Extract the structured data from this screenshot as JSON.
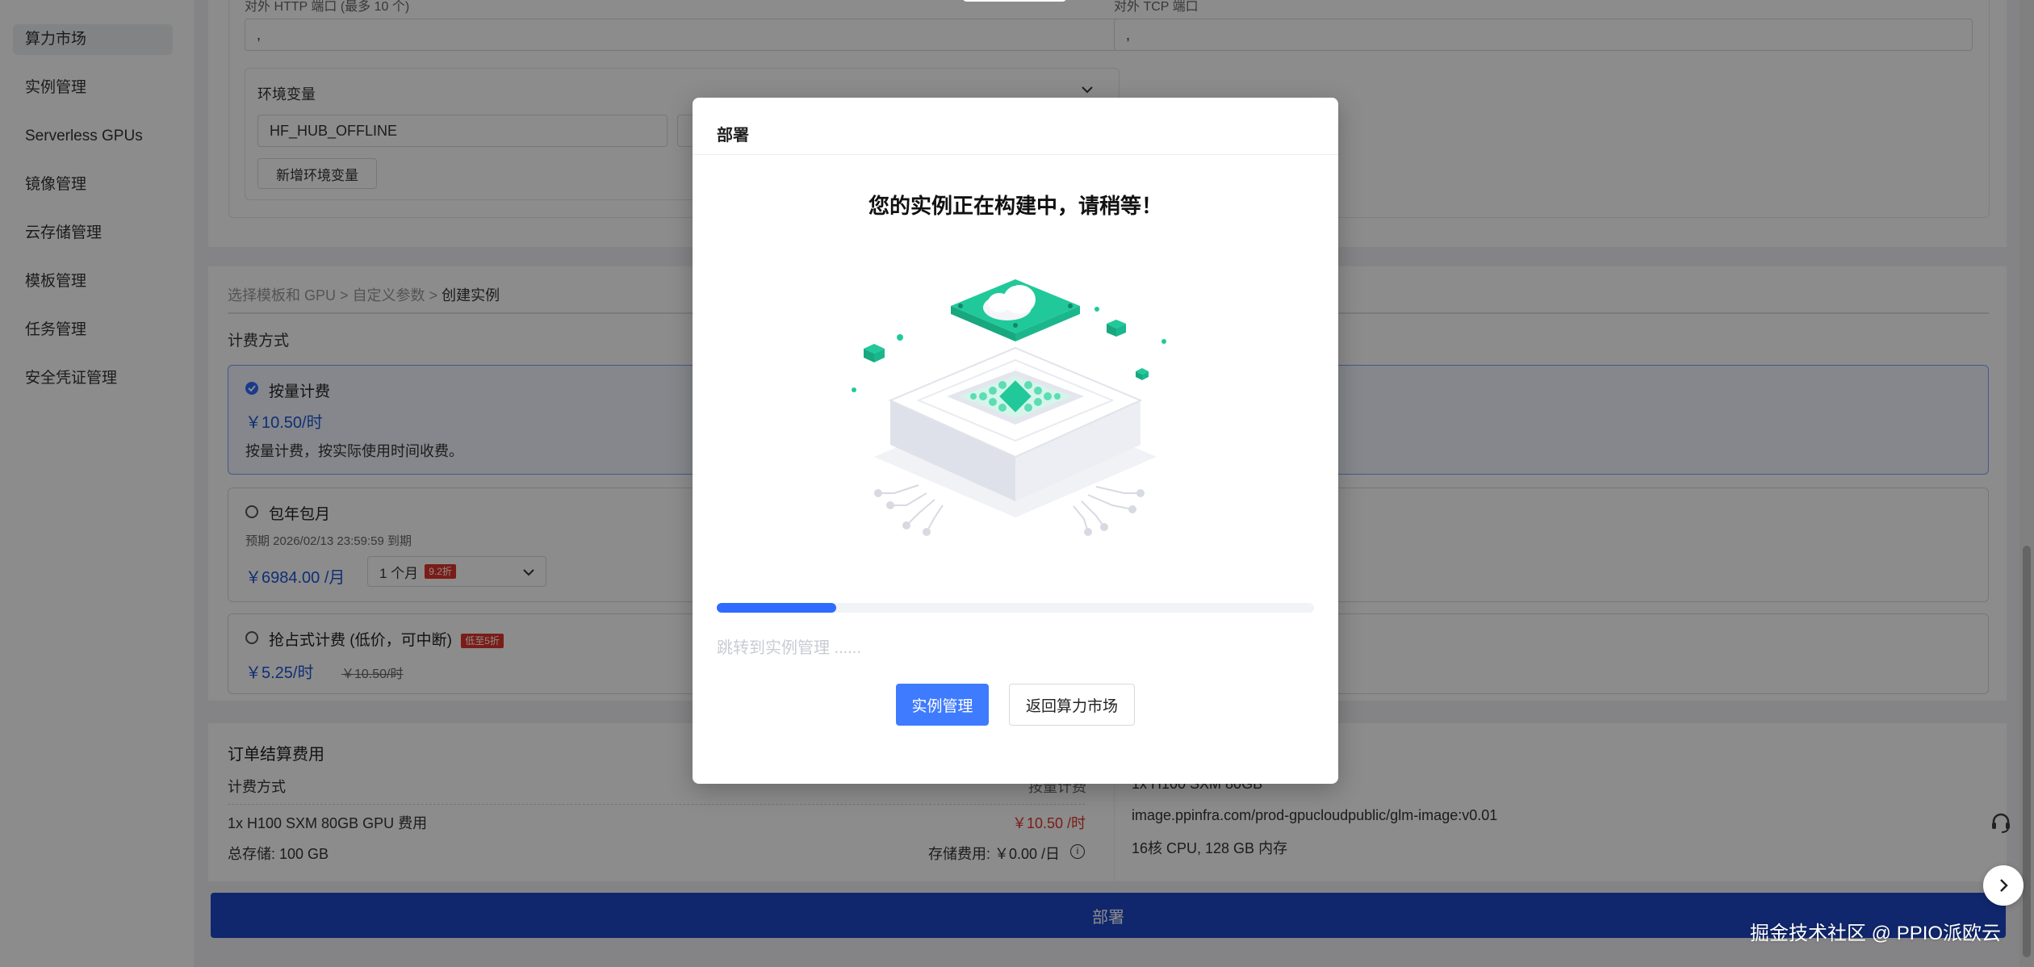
{
  "sidebar": {
    "items": [
      {
        "label": "算力市场",
        "active": true
      },
      {
        "label": "实例管理"
      },
      {
        "label": "Serverless GPUs"
      },
      {
        "label": "镜像管理"
      },
      {
        "label": "云存储管理"
      },
      {
        "label": "模板管理"
      },
      {
        "label": "任务管理"
      },
      {
        "label": "安全凭证管理"
      }
    ]
  },
  "ports": {
    "http_label": "对外 HTTP 端口 (最多 10 个)",
    "http_value": ",",
    "tcp_label": "对外 TCP 端口",
    "tcp_value": ","
  },
  "env": {
    "title": "环境变量",
    "key_value": "HF_HUB_OFFLINE",
    "add_button": "新增环境变量"
  },
  "breadcrumb": {
    "step1": "选择模板和 GPU",
    "sep1": ">",
    "step2": "自定义参数",
    "sep2": ">",
    "step3": "创建实例"
  },
  "billing": {
    "title": "计费方式",
    "options": [
      {
        "label": "按量计费",
        "price": "￥10.50/时",
        "desc": "按量计费，按实际使用时间收费。",
        "selected": true
      },
      {
        "label": "包年包月",
        "expiry": "预期  2026/02/13 23:59:59 到期",
        "price": "￥6984.00 /月",
        "duration": "1 个月",
        "duration_tag": "9.2折"
      },
      {
        "label": "抢占式计费 (低价，可中断)",
        "badge": "低至5折",
        "price": "￥5.25/时",
        "original_price": "￥10.50/时"
      }
    ]
  },
  "summary": {
    "title": "订单结算费用",
    "billing_label": "计费方式",
    "billing_value": "按量计费",
    "gpu_label": "1x H100 SXM 80GB GPU 费用",
    "gpu_price": "￥10.50 /时",
    "storage_label": "总存储: 100 GB",
    "storage_fee": "存储费用: ￥0.00 /日",
    "gpu_spec": "1x H100 SXM 80GB",
    "image": "image.ppinfra.com/prod-gpucloudpublic/glm-image:v0.01",
    "cpu": "16核 CPU, 128 GB 内存"
  },
  "deploy_button": "部署",
  "modal": {
    "title": "部署",
    "heading": "您的实例正在构建中，请稍等！",
    "progress": 0.2,
    "redirect_text": "跳转到实例管理 ......",
    "primary_button": "实例管理",
    "secondary_button": "返回算力市场"
  },
  "watermark": "掘金技术社区 @ PPIO派欧云",
  "colors": {
    "accent": "#3f7bff",
    "deploy": "#1e47c7",
    "price": "#1e56d6",
    "alert": "#e0342b",
    "illustration_green": "#21c99a"
  },
  "icons": {
    "headset": "headset-icon",
    "chevron_right": "chevron-right-icon",
    "info": "info-icon",
    "chevron_down": "chevron-down-icon"
  }
}
